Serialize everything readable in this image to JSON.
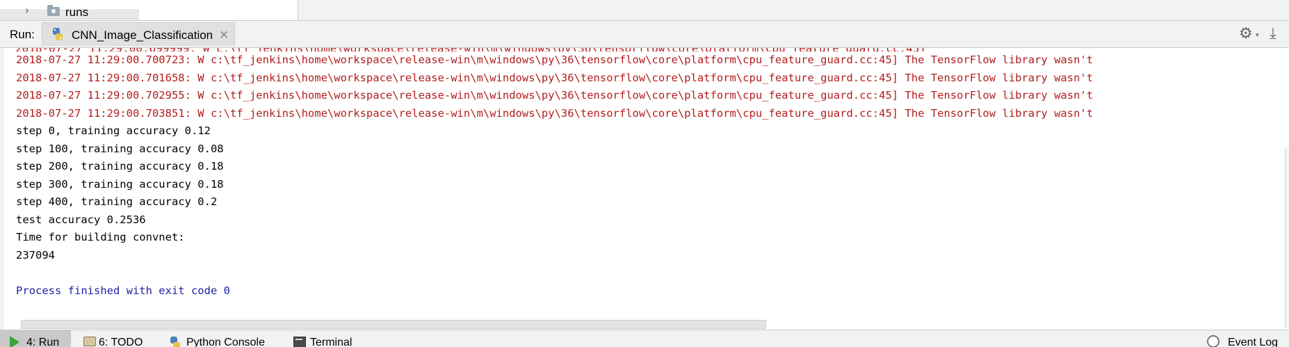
{
  "project_tree": {
    "folder_label": "runs"
  },
  "run_panel": {
    "title": "Run:",
    "tab_label": "CNN_Image_Classification",
    "close_glyph": "×"
  },
  "console": {
    "lines": [
      {
        "text": "2018-07-27 11:29:00.700723: W c:\\tf_jenkins\\home\\workspace\\release-win\\m\\windows\\py\\36\\tensorflow\\core\\platform\\cpu_feature_guard.cc:45] The TensorFlow library wasn't",
        "kind": "err"
      },
      {
        "text": "2018-07-27 11:29:00.701658: W c:\\tf_jenkins\\home\\workspace\\release-win\\m\\windows\\py\\36\\tensorflow\\core\\platform\\cpu_feature_guard.cc:45] The TensorFlow library wasn't",
        "kind": "err"
      },
      {
        "text": "2018-07-27 11:29:00.702955: W c:\\tf_jenkins\\home\\workspace\\release-win\\m\\windows\\py\\36\\tensorflow\\core\\platform\\cpu_feature_guard.cc:45] The TensorFlow library wasn't",
        "kind": "err"
      },
      {
        "text": "2018-07-27 11:29:00.703851: W c:\\tf_jenkins\\home\\workspace\\release-win\\m\\windows\\py\\36\\tensorflow\\core\\platform\\cpu_feature_guard.cc:45] The TensorFlow library wasn't",
        "kind": "err"
      },
      {
        "text": "step 0, training accuracy 0.12",
        "kind": "out"
      },
      {
        "text": "step 100, training accuracy 0.08",
        "kind": "out"
      },
      {
        "text": "step 200, training accuracy 0.18",
        "kind": "out"
      },
      {
        "text": "step 300, training accuracy 0.18",
        "kind": "out"
      },
      {
        "text": "step 400, training accuracy 0.2",
        "kind": "out"
      },
      {
        "text": "test accuracy 0.2536",
        "kind": "out"
      },
      {
        "text": "Time for building convnet:",
        "kind": "out"
      },
      {
        "text": "237094",
        "kind": "out"
      },
      {
        "text": "",
        "kind": "out"
      },
      {
        "text": "Process finished with exit code 0",
        "kind": "info"
      }
    ]
  },
  "toolbar": {
    "run_label": "4: Run",
    "todo_label": "6: TODO",
    "python_console_label": "Python Console",
    "terminal_label": "Terminal",
    "event_log_label": "Event Log"
  },
  "colors": {
    "error_text": "#b31d1d",
    "info_text": "#1f1fa8",
    "run_icon": "#3aa33a"
  }
}
